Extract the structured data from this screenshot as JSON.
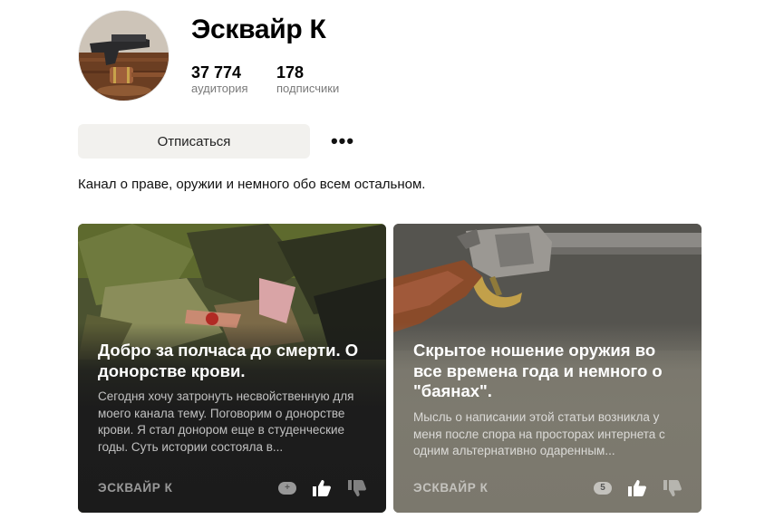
{
  "channel": {
    "name": "Эсквайр К",
    "audience_value": "37 774",
    "audience_label": "аудитория",
    "subscribers_value": "178",
    "subscribers_label": "подписчики",
    "unsubscribe_label": "Отписаться",
    "more_label": "•••",
    "description": "Канал о праве, оружии и немного обо всем остальном."
  },
  "cards": [
    {
      "title": "Добро за полчаса до смерти. О донорстве крови.",
      "snippet": "Сегодня хочу затронуть несвойственную для моего канала тему. Поговорим о донорстве крови. Я стал донором еще в студенческие годы. Суть истории состояла в...",
      "author": "ЭСКВАЙР К",
      "comments": "+",
      "icons": [
        "comment-icon",
        "like-icon",
        "dislike-icon"
      ]
    },
    {
      "title": "Скрытое ношение оружия во все времена года и немного о \"баянах\".",
      "snippet": "Мысль о написании этой статьи возникла у меня после спора на просторах интернета с одним альтернативно одаренным...",
      "author": "ЭСКВАЙР К",
      "comments": "5",
      "icons": [
        "comment-icon",
        "like-icon",
        "dislike-icon"
      ]
    }
  ],
  "colors": {
    "button_bg": "#f2f1ee",
    "card1_bg": "#1c1c1c",
    "card2_bg": "#7d7a6f",
    "muted_text": "#7a7a7a"
  }
}
